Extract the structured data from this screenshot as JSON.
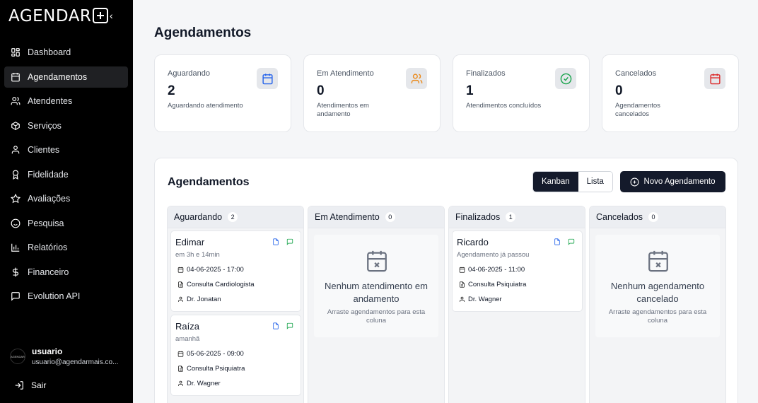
{
  "app": {
    "logo_text": "AGENDAR",
    "collapse_icon": "chevron-left-icon"
  },
  "sidebar": {
    "items": [
      {
        "label": "Dashboard",
        "icon": "dashboard-icon"
      },
      {
        "label": "Agendamentos",
        "icon": "calendar-icon",
        "active": true
      },
      {
        "label": "Atendentes",
        "icon": "users-icon"
      },
      {
        "label": "Serviços",
        "icon": "package-icon"
      },
      {
        "label": "Clientes",
        "icon": "user-icon"
      },
      {
        "label": "Fidelidade",
        "icon": "award-icon"
      },
      {
        "label": "Avaliações",
        "icon": "star-icon"
      },
      {
        "label": "Pesquisa",
        "icon": "smile-icon"
      },
      {
        "label": "Relatórios",
        "icon": "bar-chart-icon"
      },
      {
        "label": "Financeiro",
        "icon": "dollar-icon"
      },
      {
        "label": "Evolution API",
        "icon": "message-icon"
      }
    ],
    "user": {
      "name": "usuario",
      "email": "usuario@agendarmais.co...",
      "avatar_text": "AGENDAR"
    },
    "logout_label": "Sair"
  },
  "page": {
    "title": "Agendamentos"
  },
  "stats": [
    {
      "label": "Aguardando",
      "value": "2",
      "desc": "Aguardando atendimento",
      "icon": "calendar-icon",
      "color": "#2563eb"
    },
    {
      "label": "Em Atendimento",
      "value": "0",
      "desc": "Atendimentos em andamento",
      "icon": "users-icon",
      "color": "#ea8a1c"
    },
    {
      "label": "Finalizados",
      "value": "1",
      "desc": "Atendimentos concluídos",
      "icon": "check-circle-icon",
      "color": "#16a34a"
    },
    {
      "label": "Cancelados",
      "value": "0",
      "desc": "Agendamentos cancelados",
      "icon": "calendar-icon",
      "color": "#dc2626"
    }
  ],
  "panel": {
    "title": "Agendamentos",
    "view_kanban": "Kanban",
    "view_lista": "Lista",
    "new_button": "Novo Agendamento"
  },
  "columns": [
    {
      "title": "Aguardando",
      "count": "2",
      "cards": [
        {
          "name": "Edimar",
          "sub": "em 3h e 14min",
          "datetime": "04-06-2025 - 17:00",
          "service": "Consulta Cardiologista",
          "attendant": "Dr. Jonatan"
        },
        {
          "name": "Raíza",
          "sub": "amanhã",
          "datetime": "05-06-2025 - 09:00",
          "service": "Consulta Psiquiatra",
          "attendant": "Dr. Wagner"
        }
      ]
    },
    {
      "title": "Em Atendimento",
      "count": "0",
      "empty_title": "Nenhum atendimento em andamento",
      "empty_sub": "Arraste agendamentos para esta coluna"
    },
    {
      "title": "Finalizados",
      "count": "1",
      "cards": [
        {
          "name": "Ricardo",
          "sub": "Agendamento já passou",
          "datetime": "04-06-2025 - 11:00",
          "service": "Consulta Psiquiatra",
          "attendant": "Dr. Wagner"
        }
      ]
    },
    {
      "title": "Cancelados",
      "count": "0",
      "empty_title": "Nenhum agendamento cancelado",
      "empty_sub": "Arraste agendamentos para esta coluna"
    }
  ]
}
